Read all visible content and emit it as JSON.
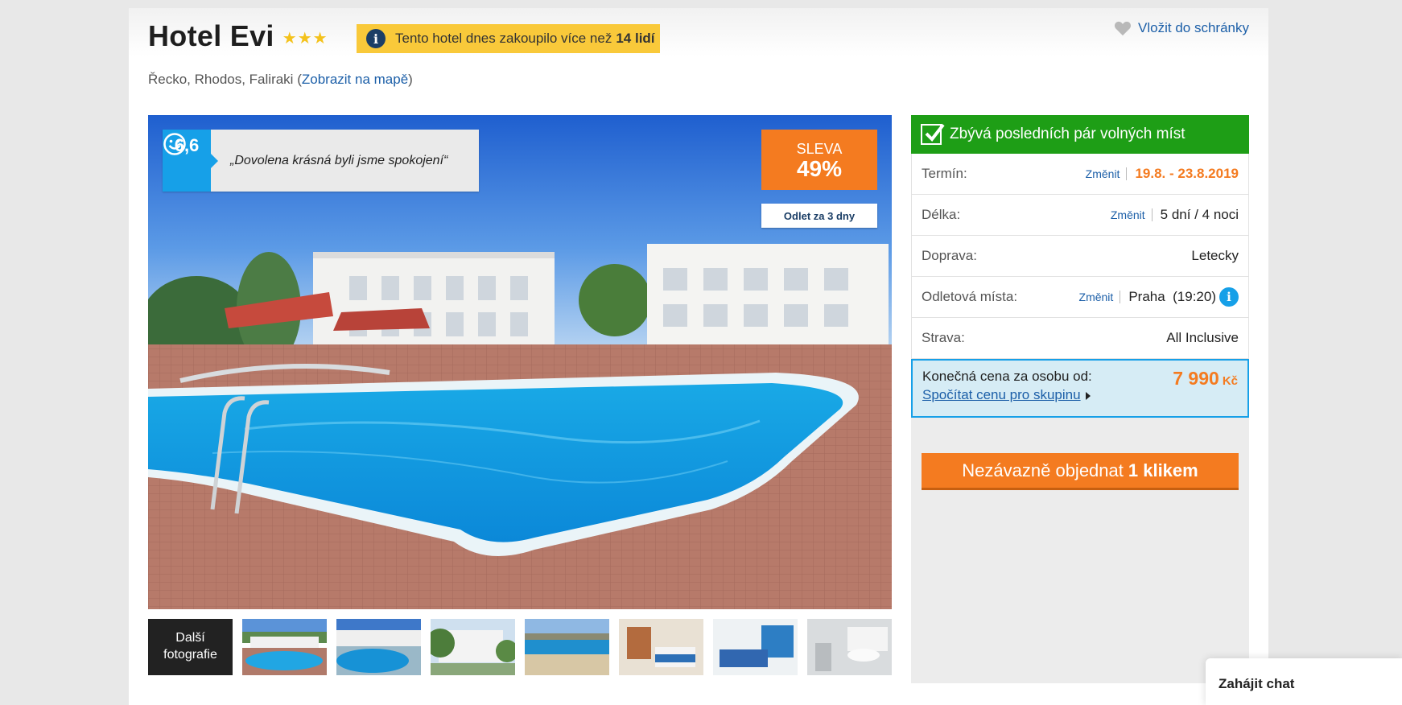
{
  "hotel": {
    "name": "Hotel Evi",
    "stars": 3,
    "popular_text": "Tento hotel dnes zakoupilo více než",
    "popular_count": "14 lidí",
    "wishlist_label": "Vložit do schránky",
    "location": "Řecko, Rhodos, Faliraki",
    "map_link": "Zobrazit na mapě"
  },
  "photo": {
    "rating": "6,6",
    "review_quote": "„Dovolena krásná byli jsme spokojení“",
    "discount_label": "SLEVA",
    "discount_value": "49%",
    "departure_badge": "Odlet za 3 dny"
  },
  "thumbnails": {
    "more_label_1": "Další",
    "more_label_2": "fotografie"
  },
  "booking": {
    "availability": "Zbývá posledních pár volných míst",
    "change_label": "Změnit",
    "rows": [
      {
        "label": "Termín:",
        "value": "19.8. - 23.8.2019"
      },
      {
        "label": "Délka:",
        "value": "5 dní / 4 noci"
      },
      {
        "label": "Doprava:",
        "value": "Letecky"
      },
      {
        "label": "Odletová místa:",
        "value": "Praha  (19:20)"
      },
      {
        "label": "Strava:",
        "value": "All Inclusive"
      }
    ],
    "price_label": "Konečná cena za osobu od:",
    "price_value": "7 990",
    "price_currency": "Kč",
    "group_price_link": "Spočítat cenu pro skupinu",
    "order_button_text": "Nezávazně objednat",
    "order_button_bold": "1 klikem"
  },
  "chat": {
    "label": "Zahájit chat"
  },
  "colors": {
    "accent_orange": "#f47b20",
    "availability_green": "#1e9e16",
    "rating_blue": "#16a0e8",
    "link_blue": "#1c5fa8",
    "banner_yellow": "#f9c93a"
  }
}
